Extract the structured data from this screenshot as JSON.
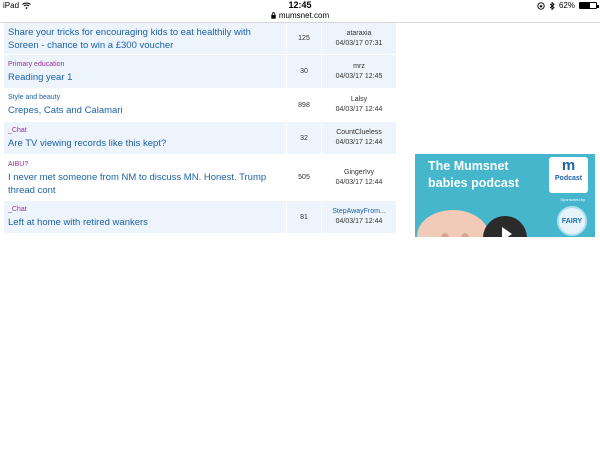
{
  "status_bar": {
    "device": "iPad",
    "time": "12:45",
    "battery_label": "62%",
    "battery_level": 0.62,
    "url": "mumsnet.com"
  },
  "threads": [
    {
      "category": "",
      "title": "Share your tricks for encouraging kids to eat healthily with Soreen - chance to win a £300 voucher",
      "count": "125",
      "user": "ataraxia",
      "time": "04/03/17 07:31",
      "shaded": true
    },
    {
      "category": "Primary education",
      "title": "Reading year 1",
      "count": "30",
      "user": "mrz",
      "time": "04/03/17 12:45",
      "shaded": true
    },
    {
      "category": "Style and beauty",
      "title": "Crepes, Cats and Calamari",
      "count": "898",
      "user": "Lalsy",
      "time": "04/03/17 12:44",
      "shaded": false
    },
    {
      "category": "_Chat",
      "title": "Are TV viewing records like this kept?",
      "count": "32",
      "user": "CountClueless",
      "time": "04/03/17 12:44",
      "shaded": true
    },
    {
      "category": "AIBU?",
      "title": "I never met someone from NM to discuss MN. Honest. Trump thread cont",
      "count": "505",
      "user": "GingerIvy",
      "time": "04/03/17 12:44",
      "shaded": false
    },
    {
      "category": "_Chat",
      "title": "Left at home with retired wankers",
      "count": "81",
      "user": "StepAwayFrom...",
      "time": "04/03/17 12:44",
      "shaded": true
    }
  ],
  "ad": {
    "line1": "The Mumsnet",
    "line2": "babies podcast",
    "logo_letter": "m",
    "logo_label": "Podcast",
    "sponsor_label": "Sponsored by",
    "sponsor_brand": "FAIRY",
    "background_color": "#45b6cc"
  }
}
